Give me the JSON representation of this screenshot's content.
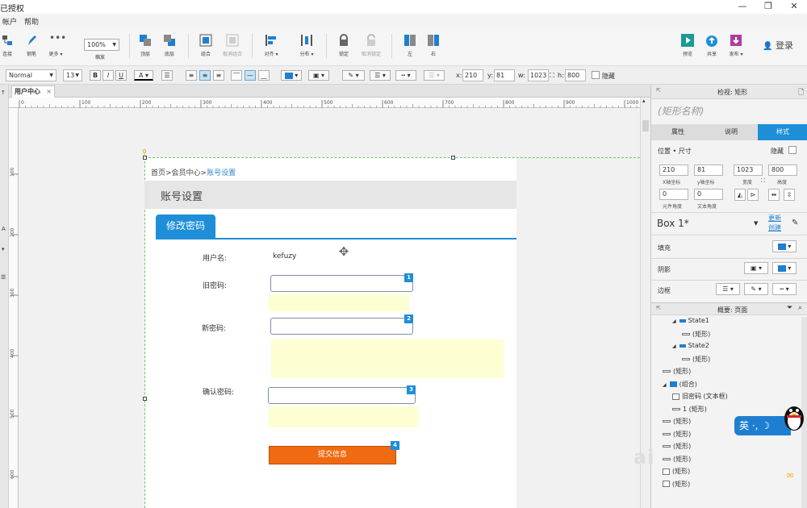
{
  "window": {
    "title": "已授权"
  },
  "menu": [
    "帐户",
    "帮助"
  ],
  "toolbar1": {
    "connect": "连接",
    "pen": "钢笔",
    "more": "更多",
    "zoom": "100%",
    "zoom_label": "缩放",
    "top": "顶层",
    "bottom": "底层",
    "group": "组合",
    "ungroup": "取消组合",
    "align": "对齐",
    "distribute": "分布",
    "lock": "锁定",
    "unlock": "取消锁定",
    "left": "左",
    "right": "右",
    "preview": "预览",
    "share": "共享",
    "publish": "发布",
    "login": "登录"
  },
  "toolbar2": {
    "style": "Normal",
    "font_size": "13",
    "bold": "B",
    "italic": "I",
    "underline": "U",
    "font_color": "A",
    "x_label": "x:",
    "x": "210",
    "y_label": "y:",
    "y": "81",
    "w_label": "w:",
    "w": "1023",
    "h_label": "h:",
    "h": "800",
    "hide": "隐藏"
  },
  "tab": {
    "label": "用户中心",
    "close": "×"
  },
  "ruler": {
    "h": [
      "0",
      "100",
      "200",
      "300",
      "400",
      "500",
      "600",
      "700",
      "800",
      "900",
      "1000"
    ],
    "v": [
      "100",
      "200",
      "300",
      "400",
      "500",
      "600"
    ]
  },
  "design": {
    "breadcrumb_prefix": "首页>会员中心>",
    "breadcrumb_current": "账号设置",
    "page_title": "账号设置",
    "tab": "修改密码",
    "username_label": "用户名:",
    "username_value": "kefuzy",
    "old_pw_label": "旧密码:",
    "new_pw_label": "新密码:",
    "confirm_label": "确认密码:",
    "submit": "提交信息",
    "badges": [
      "1",
      "2",
      "3",
      "4"
    ]
  },
  "inspector": {
    "header": "检视: 矩形",
    "name_placeholder": "(矩形名称)",
    "tabs": [
      "属性",
      "说明",
      "样式"
    ],
    "position_size": "位置 • 尺寸",
    "hide": "隐藏",
    "x": "210",
    "y": "81",
    "w": "1023",
    "h": "800",
    "x_label": "X轴坐标",
    "y_label": "y轴坐标",
    "w_label": "宽度",
    "h_label": "高度",
    "rot": "0",
    "text_rot": "0",
    "rot_label": "元件角度",
    "text_rot_label": "文本角度",
    "style_name": "Box 1*",
    "update": "更新",
    "create": "创建",
    "fill": "填充",
    "shadow": "阴影",
    "border": "边框"
  },
  "outline": {
    "header": "概要: 页面",
    "items": [
      {
        "text": "State1",
        "type": "state",
        "indent": 1
      },
      {
        "text": "(矩形)",
        "type": "rect",
        "indent": 2
      },
      {
        "text": "State2",
        "type": "state",
        "indent": 1
      },
      {
        "text": "(矩形)",
        "type": "rect",
        "indent": 2
      },
      {
        "text": "(矩形)",
        "type": "rect",
        "indent": 0
      },
      {
        "text": "(组合)",
        "type": "folder",
        "indent": 0
      },
      {
        "text": "旧密码 (文本框)",
        "type": "box",
        "indent": 1
      },
      {
        "text": "1 (矩形)",
        "type": "rect",
        "indent": 1
      },
      {
        "text": "(矩形)",
        "type": "rect",
        "indent": 0
      },
      {
        "text": "(矩形)",
        "type": "rect",
        "indent": 0
      },
      {
        "text": "(矩形)",
        "type": "rect",
        "indent": 0
      },
      {
        "text": "(矩形)",
        "type": "rect",
        "indent": 0
      },
      {
        "text": "(矩形)",
        "type": "box",
        "indent": 0
      },
      {
        "text": "(矩形)",
        "type": "box",
        "indent": 0
      }
    ]
  },
  "overlay": {
    "ime": "英 ·, ☽"
  },
  "colors": {
    "accent": "#1e8ed8",
    "submit": "#f06a11",
    "hint": "#fefed3"
  }
}
